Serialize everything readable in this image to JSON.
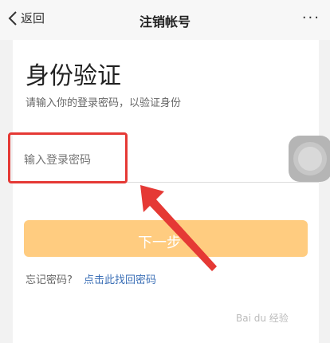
{
  "nav": {
    "back_label": "返回",
    "title": "注销帐号",
    "more_label": "···"
  },
  "main": {
    "title": "身份验证",
    "subtitle": "请输入你的登录密码，以验证身份",
    "password_placeholder": "输入登录密码",
    "next_button": "下一步"
  },
  "footer": {
    "forgot_text": "忘记密码?",
    "forgot_link": "点击此找回密码"
  },
  "colors": {
    "accent": "#ffcc80",
    "highlight": "#e53935",
    "link": "#3b6fb6"
  },
  "watermark": "Bai du 经验"
}
